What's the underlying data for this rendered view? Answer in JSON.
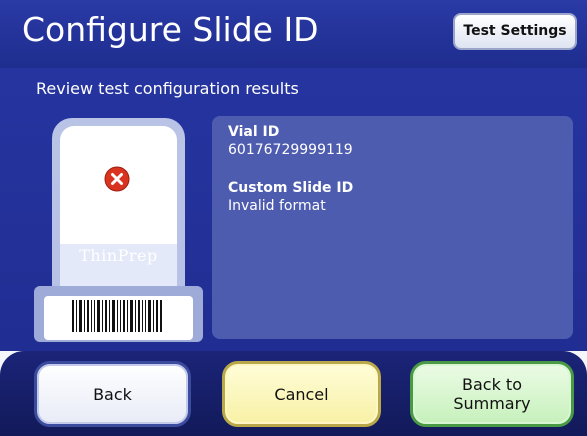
{
  "header": {
    "title": "Configure Slide ID",
    "test_settings_label": "Test Settings"
  },
  "content": {
    "subtitle": "Review test configuration results",
    "slide": {
      "brand_text": "ThinPrep",
      "status_icon": "error-x-icon",
      "status_color": "#d9341f"
    },
    "fields": [
      {
        "label": "Vial ID",
        "value": "60176729999119"
      },
      {
        "label": "Custom Slide ID",
        "value": "Invalid format"
      }
    ]
  },
  "footer": {
    "back_label": "Back",
    "cancel_label": "Cancel",
    "summary_label": "Back to Summary"
  },
  "colors": {
    "header_blue": "#2a3aa6",
    "panel_blue": "#4e5cb0",
    "footer_navy": "#1b2478",
    "error_red": "#d9341f"
  }
}
